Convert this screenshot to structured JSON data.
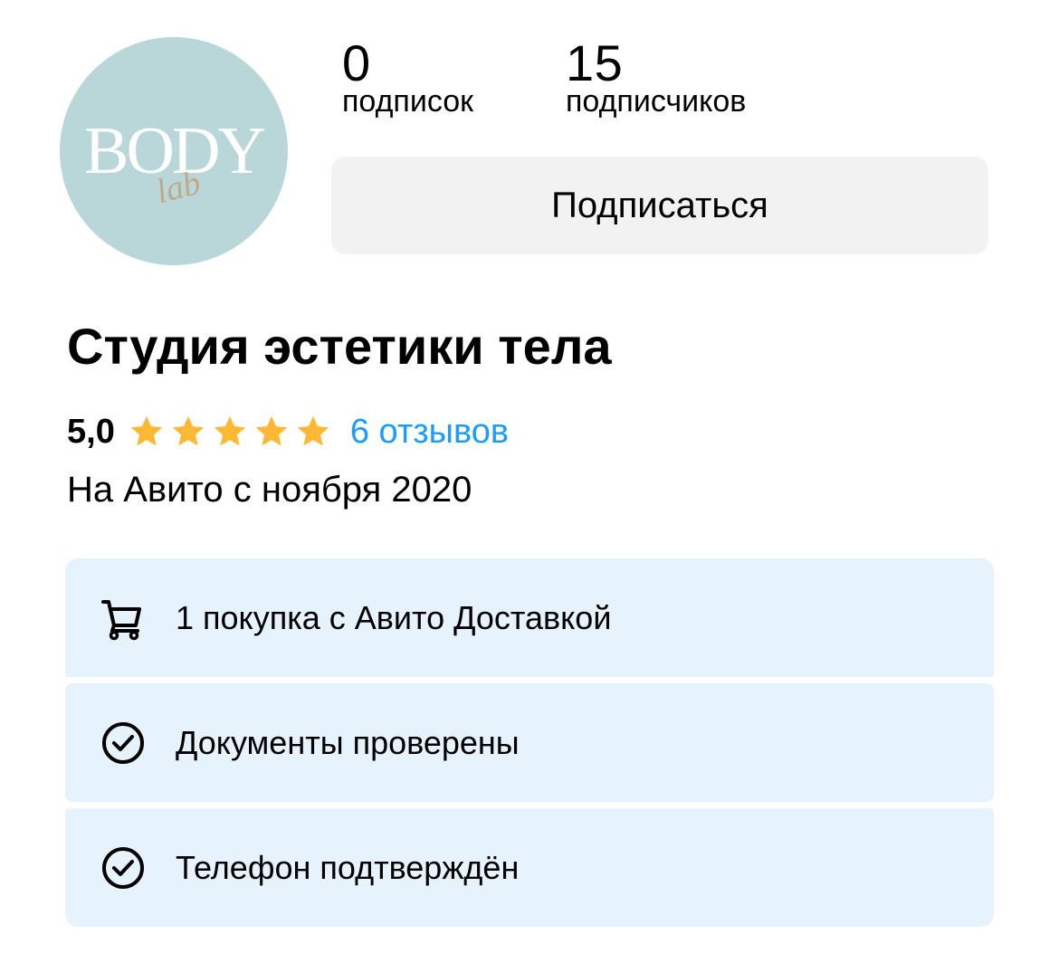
{
  "profile": {
    "avatar": {
      "logo_text": "BODY",
      "logo_script": "lab",
      "background_color": "#b9d6d8"
    },
    "stats": {
      "following_count": "0",
      "following_label": "подписок",
      "followers_count": "15",
      "followers_label": "подписчиков"
    },
    "subscribe_label": "Подписаться",
    "name": "Студия эстетики тела",
    "rating": {
      "value": "5,0",
      "stars_filled": 5,
      "stars_total": 5,
      "star_color": "#ffb833",
      "reviews_label": "6 отзывов",
      "link_color": "#1a9bff"
    },
    "member_since": "На Авито с ноября 2020"
  },
  "badges": [
    {
      "icon": "cart-icon",
      "label": "1 покупка с Авито Доставкой"
    },
    {
      "icon": "check-circle-icon",
      "label": "Документы проверены"
    },
    {
      "icon": "check-circle-icon",
      "label": "Телефон подтверждён"
    }
  ],
  "colors": {
    "button_bg": "#f2f2f2",
    "badge_bg": "#e6f3fc"
  }
}
